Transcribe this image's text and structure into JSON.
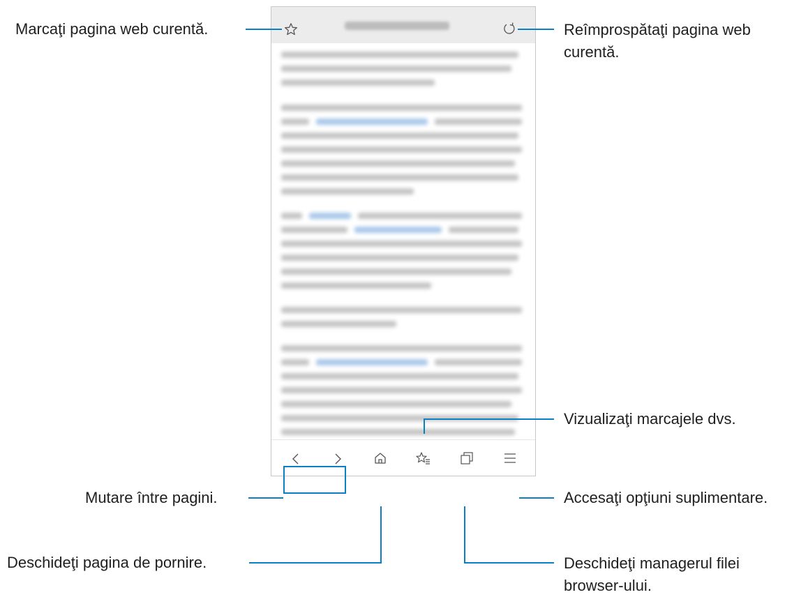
{
  "labels": {
    "bookmark": "Marcaţi pagina web curentă.",
    "refresh_l1": "Reîmprospătaţi pagina web",
    "refresh_l2": "curentă.",
    "view_bookmarks": "Vizualizaţi marcajele dvs.",
    "move_pages": "Mutare între pagini.",
    "more_options": "Accesaţi opţiuni suplimentare.",
    "home": "Deschideţi pagina de pornire.",
    "tabs_l1": "Deschideţi managerul filei",
    "tabs_l2": "browser-ului."
  },
  "icons": {
    "bookmark": "star-outline-icon",
    "refresh": "refresh-icon",
    "back": "chevron-left-icon",
    "forward": "chevron-right-icon",
    "home": "home-icon",
    "bookmarks_list": "star-list-icon",
    "tabs": "tabs-icon",
    "menu": "hamburger-menu-icon"
  },
  "colors": {
    "leader_line": "#0a7fc2",
    "icon": "#555555"
  }
}
